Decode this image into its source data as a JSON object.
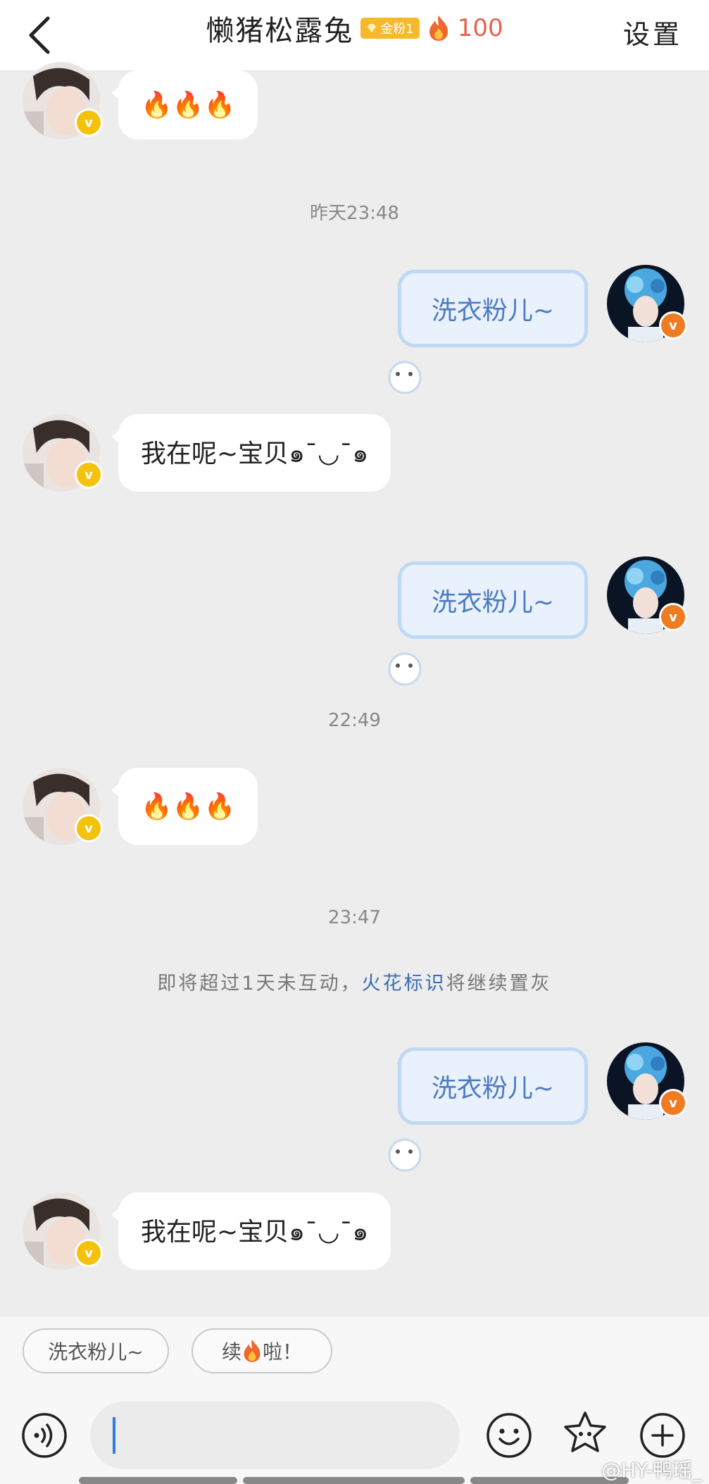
{
  "header": {
    "title": "懒猪松露兔",
    "fan_badge": "金粉1",
    "streak_count": "100",
    "settings_label": "设置"
  },
  "messages": {
    "m1_fires": "🔥🔥🔥",
    "t1": "昨天23:48",
    "m2": "洗衣粉儿~",
    "m3": "我在呢~宝贝๑¯◡¯๑",
    "m4": "洗衣粉儿~",
    "t2": "22:49",
    "m5_fires": "🔥🔥🔥",
    "t3": "23:47",
    "notice_prefix": "即将超过1天未互动，",
    "notice_link": "火花标识",
    "notice_suffix": "将继续置灰",
    "m6": "洗衣粉儿~",
    "m7": "我在呢~宝贝๑¯◡¯๑"
  },
  "quick_replies": {
    "chip1": "洗衣粉儿~",
    "chip2_prefix": "续",
    "chip2_suffix": "啦！"
  },
  "input": {
    "value": "",
    "placeholder": ""
  },
  "icons": [
    "voice-icon",
    "emoji-icon",
    "sticker-star-icon",
    "plus-icon"
  ],
  "watermark": "@HY-鸭瑶_",
  "colors": {
    "accent": "#3b6cb5",
    "streak": "#e8624a",
    "badge": "#f6b92c"
  }
}
